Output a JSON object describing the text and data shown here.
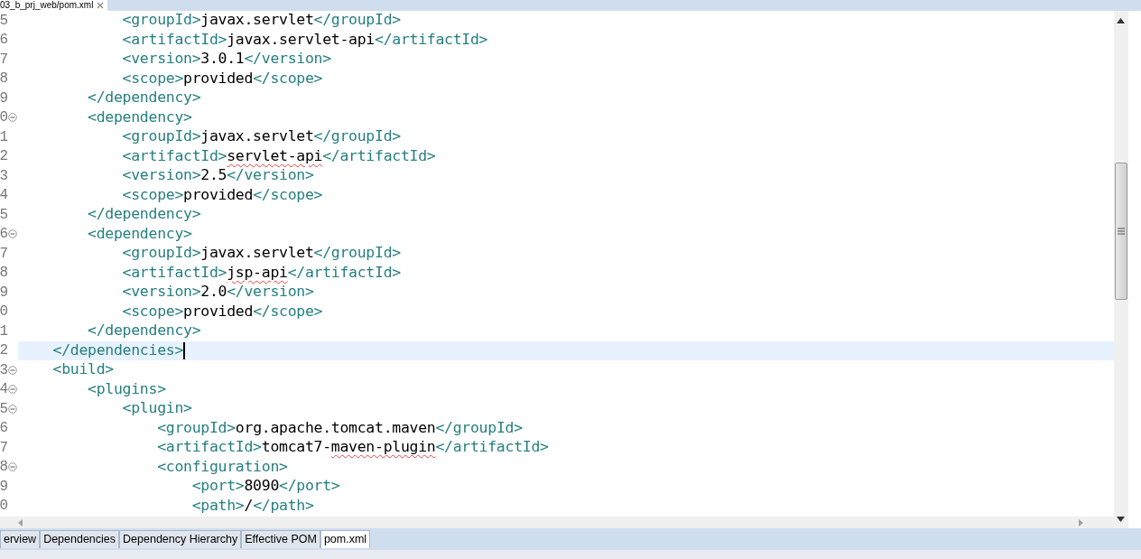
{
  "editor_tab": {
    "title": "03_b_prj_web/pom.xml"
  },
  "lines": [
    {
      "number": "5",
      "fold": false,
      "current": false,
      "cursor": false,
      "tokens": [
        {
          "kind": "tag",
          "text": "            <groupId>"
        },
        {
          "kind": "text",
          "text": "javax.servlet",
          "misspelled": false
        },
        {
          "kind": "tag",
          "text": "</groupId>"
        }
      ]
    },
    {
      "number": "6",
      "fold": false,
      "current": false,
      "cursor": false,
      "tokens": [
        {
          "kind": "tag",
          "text": "            <artifactId>"
        },
        {
          "kind": "text",
          "text": "javax.servlet-api",
          "misspelled": false
        },
        {
          "kind": "tag",
          "text": "</artifactId>"
        }
      ]
    },
    {
      "number": "7",
      "fold": false,
      "current": false,
      "cursor": false,
      "tokens": [
        {
          "kind": "tag",
          "text": "            <version>"
        },
        {
          "kind": "text",
          "text": "3.0.1",
          "misspelled": false
        },
        {
          "kind": "tag",
          "text": "</version>"
        }
      ]
    },
    {
      "number": "8",
      "fold": false,
      "current": false,
      "cursor": false,
      "tokens": [
        {
          "kind": "tag",
          "text": "            <scope>"
        },
        {
          "kind": "text",
          "text": "provided",
          "misspelled": false
        },
        {
          "kind": "tag",
          "text": "</scope>"
        }
      ]
    },
    {
      "number": "9",
      "fold": false,
      "current": false,
      "cursor": false,
      "tokens": [
        {
          "kind": "tag",
          "text": "        </dependency>"
        }
      ]
    },
    {
      "number": "0",
      "fold": true,
      "current": false,
      "cursor": false,
      "tokens": [
        {
          "kind": "tag",
          "text": "        <dependency>"
        }
      ]
    },
    {
      "number": "1",
      "fold": false,
      "current": false,
      "cursor": false,
      "tokens": [
        {
          "kind": "tag",
          "text": "            <groupId>"
        },
        {
          "kind": "text",
          "text": "javax.servlet",
          "misspelled": false
        },
        {
          "kind": "tag",
          "text": "</groupId>"
        }
      ]
    },
    {
      "number": "2",
      "fold": false,
      "current": false,
      "cursor": false,
      "tokens": [
        {
          "kind": "tag",
          "text": "            <artifactId>"
        },
        {
          "kind": "text",
          "text": "servlet-api",
          "misspelled": true
        },
        {
          "kind": "tag",
          "text": "</artifactId>"
        }
      ]
    },
    {
      "number": "3",
      "fold": false,
      "current": false,
      "cursor": false,
      "tokens": [
        {
          "kind": "tag",
          "text": "            <version>"
        },
        {
          "kind": "text",
          "text": "2.5",
          "misspelled": false
        },
        {
          "kind": "tag",
          "text": "</version>"
        }
      ]
    },
    {
      "number": "4",
      "fold": false,
      "current": false,
      "cursor": false,
      "tokens": [
        {
          "kind": "tag",
          "text": "            <scope>"
        },
        {
          "kind": "text",
          "text": "provided",
          "misspelled": false
        },
        {
          "kind": "tag",
          "text": "</scope>"
        }
      ]
    },
    {
      "number": "5",
      "fold": false,
      "current": false,
      "cursor": false,
      "tokens": [
        {
          "kind": "tag",
          "text": "        </dependency>"
        }
      ]
    },
    {
      "number": "6",
      "fold": true,
      "current": false,
      "cursor": false,
      "tokens": [
        {
          "kind": "tag",
          "text": "        <dependency>"
        }
      ]
    },
    {
      "number": "7",
      "fold": false,
      "current": false,
      "cursor": false,
      "tokens": [
        {
          "kind": "tag",
          "text": "            <groupId>"
        },
        {
          "kind": "text",
          "text": "javax.servlet",
          "misspelled": false
        },
        {
          "kind": "tag",
          "text": "</groupId>"
        }
      ]
    },
    {
      "number": "8",
      "fold": false,
      "current": false,
      "cursor": false,
      "tokens": [
        {
          "kind": "tag",
          "text": "            <artifactId>"
        },
        {
          "kind": "text",
          "text": "jsp-api",
          "misspelled": true
        },
        {
          "kind": "tag",
          "text": "</artifactId>"
        }
      ]
    },
    {
      "number": "9",
      "fold": false,
      "current": false,
      "cursor": false,
      "tokens": [
        {
          "kind": "tag",
          "text": "            <version>"
        },
        {
          "kind": "text",
          "text": "2.0",
          "misspelled": false
        },
        {
          "kind": "tag",
          "text": "</version>"
        }
      ]
    },
    {
      "number": "0",
      "fold": false,
      "current": false,
      "cursor": false,
      "tokens": [
        {
          "kind": "tag",
          "text": "            <scope>"
        },
        {
          "kind": "text",
          "text": "provided",
          "misspelled": false
        },
        {
          "kind": "tag",
          "text": "</scope>"
        }
      ]
    },
    {
      "number": "1",
      "fold": false,
      "current": false,
      "cursor": false,
      "tokens": [
        {
          "kind": "tag",
          "text": "        </dependency>"
        }
      ]
    },
    {
      "number": "2",
      "fold": false,
      "current": true,
      "cursor": true,
      "tokens": [
        {
          "kind": "tag",
          "text": "    </dependencies>"
        }
      ]
    },
    {
      "number": "3",
      "fold": true,
      "current": false,
      "cursor": false,
      "tokens": [
        {
          "kind": "tag",
          "text": "    <build>"
        }
      ]
    },
    {
      "number": "4",
      "fold": true,
      "current": false,
      "cursor": false,
      "tokens": [
        {
          "kind": "tag",
          "text": "        <plugins>"
        }
      ]
    },
    {
      "number": "5",
      "fold": true,
      "current": false,
      "cursor": false,
      "tokens": [
        {
          "kind": "tag",
          "text": "            <plugin>"
        }
      ]
    },
    {
      "number": "6",
      "fold": false,
      "current": false,
      "cursor": false,
      "tokens": [
        {
          "kind": "tag",
          "text": "                <groupId>"
        },
        {
          "kind": "text",
          "text": "org.apache.tomcat.maven",
          "misspelled": false
        },
        {
          "kind": "tag",
          "text": "</groupId>"
        }
      ]
    },
    {
      "number": "7",
      "fold": false,
      "current": false,
      "cursor": false,
      "tokens": [
        {
          "kind": "tag",
          "text": "                <artifactId>"
        },
        {
          "kind": "text",
          "text": "tomcat7-",
          "misspelled": false
        },
        {
          "kind": "text",
          "text": "maven-plugin",
          "misspelled": true
        },
        {
          "kind": "tag",
          "text": "</artifactId>"
        }
      ]
    },
    {
      "number": "8",
      "fold": true,
      "current": false,
      "cursor": false,
      "tokens": [
        {
          "kind": "tag",
          "text": "                <configuration>"
        }
      ]
    },
    {
      "number": "9",
      "fold": false,
      "current": false,
      "cursor": false,
      "tokens": [
        {
          "kind": "tag",
          "text": "                    <port>"
        },
        {
          "kind": "text",
          "text": "8090",
          "misspelled": false
        },
        {
          "kind": "tag",
          "text": "</port>"
        }
      ]
    },
    {
      "number": "0",
      "fold": false,
      "current": false,
      "cursor": false,
      "tokens": [
        {
          "kind": "tag",
          "text": "                    <path>"
        },
        {
          "kind": "text",
          "text": "/",
          "misspelled": false
        },
        {
          "kind": "tag",
          "text": "</path>"
        }
      ]
    }
  ],
  "page_tabs": [
    {
      "label": "erview",
      "selected": false
    },
    {
      "label": "Dependencies",
      "selected": false
    },
    {
      "label": "Dependency Hierarchy",
      "selected": false
    },
    {
      "label": "Effective POM",
      "selected": false
    },
    {
      "label": "pom.xml",
      "selected": true
    }
  ]
}
